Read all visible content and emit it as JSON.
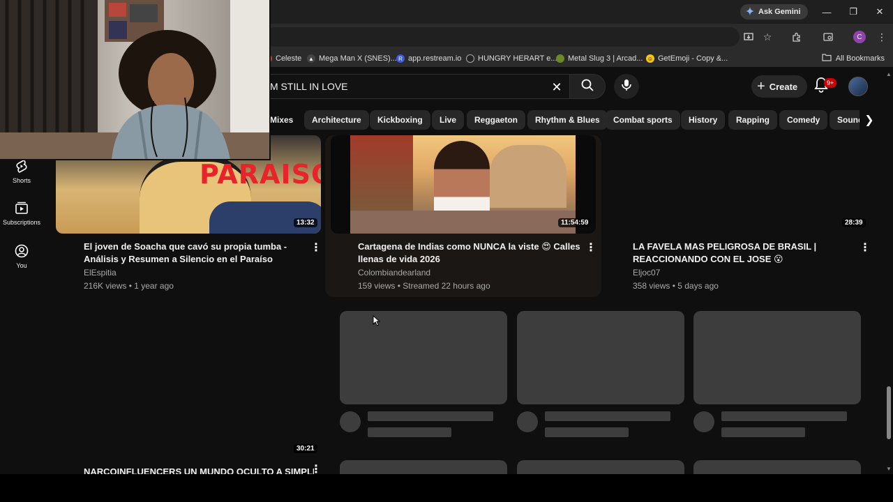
{
  "browser": {
    "ask_gemini": "Ask Gemini",
    "bookmarks": [
      "Celeste",
      "Mega Man X (SNES)...",
      "app.restream.io",
      "HUNGRY HERART e...",
      "Metal Slug 3 | Arcad...",
      "GetEmoji - Copy &..."
    ],
    "all_bookmarks": "All Bookmarks",
    "profile_initial": "C"
  },
  "youtube": {
    "search_query": "M STILL IN LOVE",
    "create_label": "Create",
    "notif_badge": "9+",
    "chips": [
      "Mixes",
      "Architecture",
      "Kickboxing",
      "Live",
      "Reggaeton",
      "Rhythm & Blues",
      "Combat sports",
      "History",
      "Rapping",
      "Comedy",
      "Sound"
    ],
    "sidebar": [
      {
        "label": "Shorts",
        "icon": "shorts-icon"
      },
      {
        "label": "Subscriptions",
        "icon": "subscriptions-icon"
      },
      {
        "label": "You",
        "icon": "you-icon"
      }
    ],
    "videos": [
      {
        "thumb_text": "PARAISO",
        "duration": "13:32",
        "title": "El joven de Soacha que cavó su propia tumba - Análisis y Resumen a Silencio en el Paraíso",
        "channel": "ElEspitia",
        "meta": "216K views • 1 year ago"
      },
      {
        "duration": "11:54:59",
        "title": "Cartagena de Indias como NUNCA la viste 😍 Calles llenas de vida 2026",
        "channel": "Colombiandearland",
        "meta": "159 views • Streamed 22 hours ago"
      },
      {
        "duration": "28:39",
        "title": "LA FAVELA MAS PELIGROSA DE BRASIL | REACCIONANDO CON EL JOSE 😮",
        "channel": "Eljoc07",
        "meta": "358 views • 5 days ago"
      },
      {
        "duration": "30:21",
        "title": "NARCOINFLUENCERS UN MUNDO OCULTO A SIMPLE"
      }
    ]
  }
}
